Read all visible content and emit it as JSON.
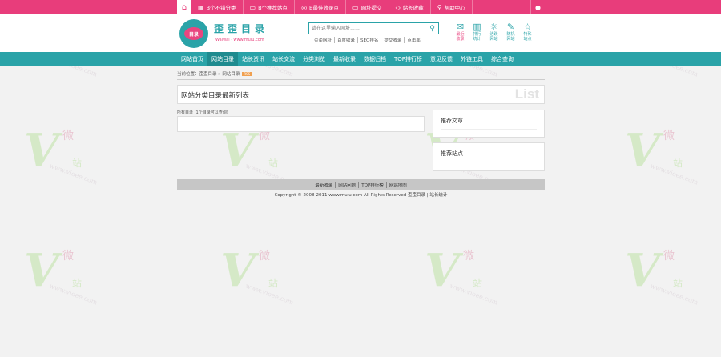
{
  "watermark": {
    "letter": "V",
    "char1": "微",
    "char2": "站",
    "url": "www.vioee.com",
    "mid": "e"
  },
  "topbar": {
    "items": [
      {
        "icon": "▦",
        "label": "B个不错分类"
      },
      {
        "icon": "▭",
        "label": "B个推荐站点"
      },
      {
        "icon": "◎",
        "label": "B最佳收录点"
      },
      {
        "icon": "▭",
        "label": "网址提交"
      },
      {
        "icon": "◇",
        "label": "站长收藏"
      },
      {
        "icon": "⚲",
        "label": "帮助中心"
      }
    ]
  },
  "logo": {
    "badge": "目录",
    "title": "歪歪目录",
    "subtitle": "Waiwai · www.mulu.com"
  },
  "search": {
    "placeholder": "请在这里输入网址……",
    "hotlinks": [
      "歪歪网址",
      "百度收录",
      "SEO排名",
      "提交收录",
      "点击率"
    ]
  },
  "quick": [
    {
      "icon": "✉",
      "l1": "最近",
      "l2": "收录"
    },
    {
      "icon": "▥",
      "l1": "排行",
      "l2": "统计"
    },
    {
      "icon": "☼",
      "l1": "活跃",
      "l2": "网站"
    },
    {
      "icon": "✎",
      "l1": "随机",
      "l2": "网站"
    },
    {
      "icon": "☆",
      "l1": "特殊",
      "l2": "站点"
    }
  ],
  "nav": {
    "items": [
      "网站首页",
      "网站目录",
      "站长资讯",
      "站长交流",
      "分类浏览",
      "最新收录",
      "数据归档",
      "TOP排行榜",
      "意见反馈",
      "外链工具",
      "综合查询"
    ],
    "active_index": 1
  },
  "crumb": {
    "text": "当前位置：歪歪目录 » 网站目录",
    "badge": "RSS"
  },
  "main": {
    "title": "网站分类目录最新列表",
    "title_en": "List",
    "label": "所有目录 (1个目录可以查询)"
  },
  "side": {
    "box1_title": "推荐文章",
    "box2_title": "推荐站点"
  },
  "footer": {
    "links": [
      "最新收录",
      "网站问题",
      "TOP排行榜",
      "网站地图"
    ],
    "copyright": "Copyright © 2008-2011 www.mulu.com All Rights Reserved 歪歪目录 | 站长统计"
  }
}
